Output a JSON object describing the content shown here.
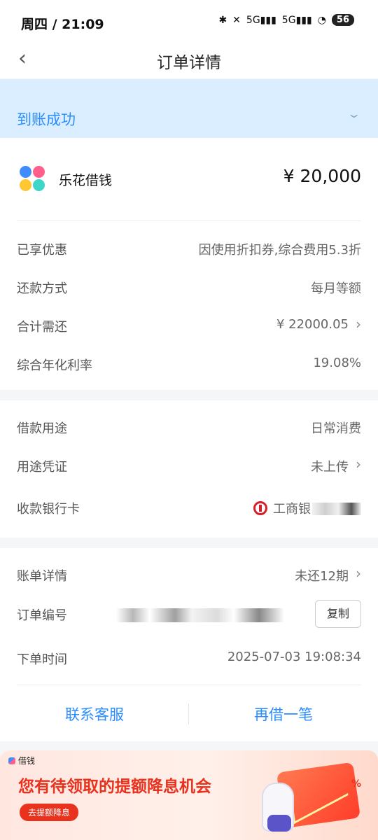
{
  "status_bar": {
    "time": "周四 / 21:09",
    "signal": "5G",
    "battery": "56"
  },
  "nav": {
    "title": "订单详情"
  },
  "banner": {
    "status": "到账成功"
  },
  "product": {
    "name": "乐花借钱",
    "amount": "¥ 20,000"
  },
  "details1": [
    {
      "key": "已享优惠",
      "value": "因使用折扣券,综合费用5.3折",
      "arrow": false
    },
    {
      "key": "还款方式",
      "value": "每月等额",
      "arrow": false
    },
    {
      "key": "合计需还",
      "value": "¥ 22000.05",
      "arrow": true
    },
    {
      "key": "综合年化利率",
      "value": "19.08%",
      "arrow": false
    }
  ],
  "details2": [
    {
      "key": "借款用途",
      "value": "日常消费",
      "arrow": false
    },
    {
      "key": "用途凭证",
      "value": "未上传",
      "arrow": true
    },
    {
      "key": "收款银行卡",
      "value": "工商银",
      "arrow": false
    }
  ],
  "details3": {
    "bill": {
      "key": "账单详情",
      "value": "未还12期"
    },
    "order": {
      "key": "订单编号",
      "copy": "复制"
    },
    "time": {
      "key": "下单时间",
      "value": "2025-07-03 19:08:34"
    }
  },
  "actions": {
    "service": "联系客服",
    "borrow_again": "再借一笔"
  },
  "ad": {
    "brand": "借钱",
    "headline": "您有待领取的提额降息机会",
    "cta": "去提额降息",
    "badge": "%"
  },
  "colors": {
    "accent": "#2b8cff",
    "banner_bg": "#dbeeff",
    "ad_red": "#e8321e"
  }
}
